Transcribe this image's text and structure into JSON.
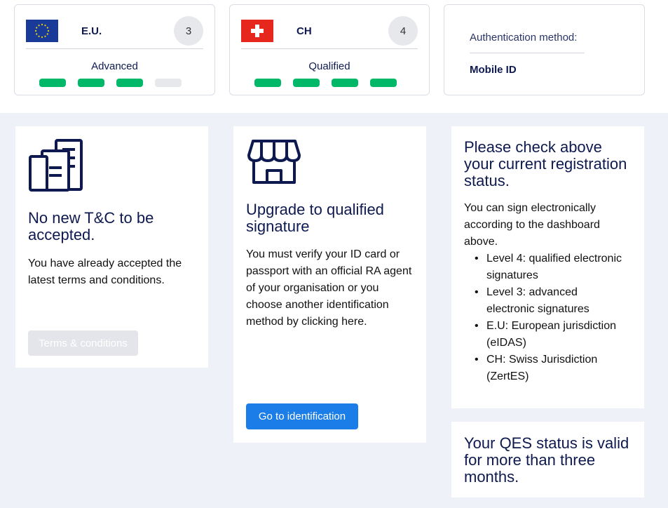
{
  "status": {
    "eu": {
      "jurisdiction": "E.U.",
      "level": "3",
      "level_name": "Advanced",
      "progress": 3,
      "total": 4
    },
    "ch": {
      "jurisdiction": "CH",
      "level": "4",
      "level_name": "Qualified",
      "progress": 4,
      "total": 4
    },
    "auth": {
      "label": "Authentication method:",
      "value": "Mobile ID"
    }
  },
  "panels": {
    "tc": {
      "icon": "document-stack-icon",
      "title": "No new T&C to be accepted.",
      "text": "You have already accepted the latest terms and conditions.",
      "button": "Terms & conditions"
    },
    "upgrade": {
      "icon": "shop-icon",
      "title": "Upgrade to qualified signature",
      "text": "You must verify your ID card or passport with an official RA agent of your organisation or you choose another identification method by clicking here.",
      "button": "Go to identification"
    },
    "info": {
      "title": "Please check above your current registration status.",
      "text": "You can sign electronically according to the dashboard above.",
      "bullets": [
        "Level 4: qualified electronic signatures",
        "Level 3: advanced electronic signatures",
        "E.U: European jurisdiction (eIDAS)",
        "CH: Swiss Jurisdiction (ZertES)"
      ]
    },
    "qes": {
      "title": "Your QES status is valid for more than three months."
    }
  },
  "colors": {
    "accent": "#1a7de8",
    "success": "#00b868",
    "navy": "#0e1a4f",
    "background": "#eef2f8"
  }
}
